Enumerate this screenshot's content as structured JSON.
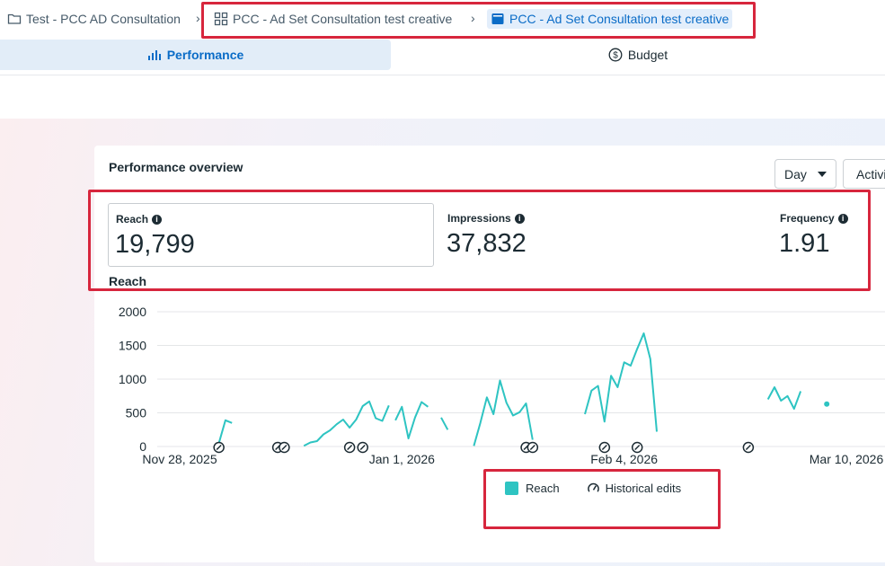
{
  "breadcrumb": {
    "campaign": "Test - PCC AD Consultation",
    "ad_set": "PCC - Ad Set Consultation test creative",
    "ad": "PCC - Ad Set Consultation test creative",
    "separator": "›"
  },
  "tabs": {
    "performance": "Performance",
    "budget": "Budget"
  },
  "card": {
    "title": "Performance overview"
  },
  "controls": {
    "day": "Day",
    "activity": "Activity"
  },
  "metrics": {
    "reach": {
      "label": "Reach",
      "value": "19,799"
    },
    "impressions": {
      "label": "Impressions",
      "value": "37,832"
    },
    "frequency": {
      "label": "Frequency",
      "value": "1.91"
    }
  },
  "colors": {
    "accent": "#0a6cc7",
    "series": "#2ec4c2",
    "highlight": "#d7263d"
  },
  "chart_data": {
    "type": "line",
    "title": "Reach",
    "ylim": [
      0,
      2000
    ],
    "yticks": [
      "0",
      "500",
      "1000",
      "1500",
      "2000"
    ],
    "xticks": [
      "Nov 28, 2025",
      "Jan 1, 2026",
      "Feb 4, 2026",
      "Mar 10, 2026"
    ],
    "grid": true,
    "legend_position": "bottom",
    "series": [
      {
        "name": "Reach",
        "segments": [
          [
            [
              "2025-12-04",
              50
            ],
            [
              "2025-12-05",
              390
            ],
            [
              "2025-12-06",
              350
            ]
          ],
          [
            [
              "2025-12-17",
              10
            ],
            [
              "2025-12-18",
              60
            ],
            [
              "2025-12-19",
              80
            ],
            [
              "2025-12-20",
              180
            ],
            [
              "2025-12-21",
              240
            ],
            [
              "2025-12-22",
              330
            ],
            [
              "2025-12-23",
              400
            ],
            [
              "2025-12-24",
              280
            ],
            [
              "2025-12-25",
              400
            ],
            [
              "2025-12-26",
              600
            ],
            [
              "2025-12-27",
              670
            ],
            [
              "2025-12-28",
              420
            ],
            [
              "2025-12-29",
              380
            ],
            [
              "2025-12-30",
              610
            ]
          ],
          [
            [
              "2025-12-31",
              390
            ],
            [
              "2026-01-01",
              590
            ],
            [
              "2026-01-02",
              120
            ],
            [
              "2026-01-03",
              430
            ],
            [
              "2026-01-04",
              660
            ],
            [
              "2026-01-05",
              590
            ]
          ],
          [
            [
              "2026-01-07",
              430
            ],
            [
              "2026-01-08",
              250
            ]
          ],
          [
            [
              "2026-01-12",
              10
            ],
            [
              "2026-01-13",
              350
            ],
            [
              "2026-01-14",
              730
            ],
            [
              "2026-01-15",
              480
            ],
            [
              "2026-01-16",
              980
            ],
            [
              "2026-01-17",
              650
            ],
            [
              "2026-01-18",
              460
            ],
            [
              "2026-01-19",
              510
            ],
            [
              "2026-01-20",
              640
            ],
            [
              "2026-01-21",
              100
            ]
          ],
          [
            [
              "2026-01-29",
              480
            ],
            [
              "2026-01-30",
              830
            ],
            [
              "2026-01-31",
              900
            ],
            [
              "2026-02-01",
              370
            ],
            [
              "2026-02-02",
              1050
            ],
            [
              "2026-02-03",
              880
            ],
            [
              "2026-02-04",
              1250
            ],
            [
              "2026-02-05",
              1200
            ],
            [
              "2026-02-06",
              1450
            ],
            [
              "2026-02-07",
              1680
            ],
            [
              "2026-02-08",
              1300
            ],
            [
              "2026-02-09",
              220
            ]
          ],
          [
            [
              "2026-02-26",
              700
            ],
            [
              "2026-02-27",
              880
            ],
            [
              "2026-02-28",
              680
            ],
            [
              "2026-03-01",
              750
            ],
            [
              "2026-03-02",
              560
            ],
            [
              "2026-03-03",
              820
            ]
          ],
          [
            [
              "2026-03-07",
              630
            ]
          ]
        ]
      }
    ],
    "historical_edits": [
      "2025-12-04",
      "2025-12-13",
      "2025-12-14",
      "2025-12-24",
      "2025-12-26",
      "2026-01-20",
      "2026-01-21",
      "2026-02-01",
      "2026-02-06",
      "2026-02-23"
    ]
  },
  "legend": {
    "reach": "Reach",
    "historical_edits": "Historical edits"
  }
}
